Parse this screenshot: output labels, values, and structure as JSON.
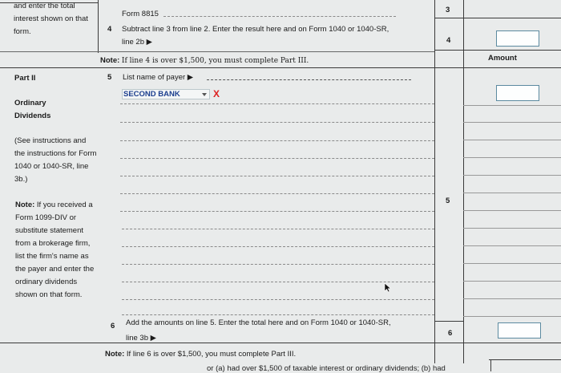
{
  "left_col": {
    "top_text": "and enter the total interest shown on that form.",
    "part_label": "Part II",
    "section_title": "Ordinary Dividends",
    "see_instructions": "(See instructions and the instructions for Form 1040 or 1040-SR, line 3b.)",
    "note_bold": "Note:",
    "note_text": "If you received a Form 1099-DIV or substitute statement from a brokerage firm, list the firm's name as the payer and enter the ordinary dividends shown on that form."
  },
  "lines": {
    "form8815": "Form 8815",
    "line3_num": "3",
    "line4_num": "4",
    "line4_text": "Subtract line 3 from line 2. Enter the result here and on Form 1040 or 1040-SR,",
    "line4_text2": "line 2b ▶",
    "line4_box": "4",
    "note4_bold": "Note:",
    "note4_text": "If line 4 is over $1,500, you must complete Part III.",
    "amount_header": "Amount",
    "line5_num": "5",
    "line5_text": "List name of payer ▶",
    "payer_selected": "SECOND BANK",
    "remove_mark": "X",
    "line5_box": "5",
    "line6_num": "6",
    "line6_text": "Add the amounts on line 5. Enter the total here and on Form 1040 or 1040-SR,",
    "line6_text2": "line 3b ▶",
    "line6_box": "6",
    "note6_bold": "Note:",
    "note6_text": "If line 6 is over $1,500, you must complete Part III.",
    "bottom_cut": "or (a) had over $1,500 of taxable interest or ordinary dividends; (b) had"
  },
  "colors": {
    "link_blue": "#1d3f8f",
    "remove_red": "#dd2222",
    "input_border": "#5c8aa0"
  },
  "icons": {
    "dropdown": "chevron-down-icon",
    "cursor": "mouse-cursor-icon",
    "arrow": "triangle-right-icon"
  }
}
